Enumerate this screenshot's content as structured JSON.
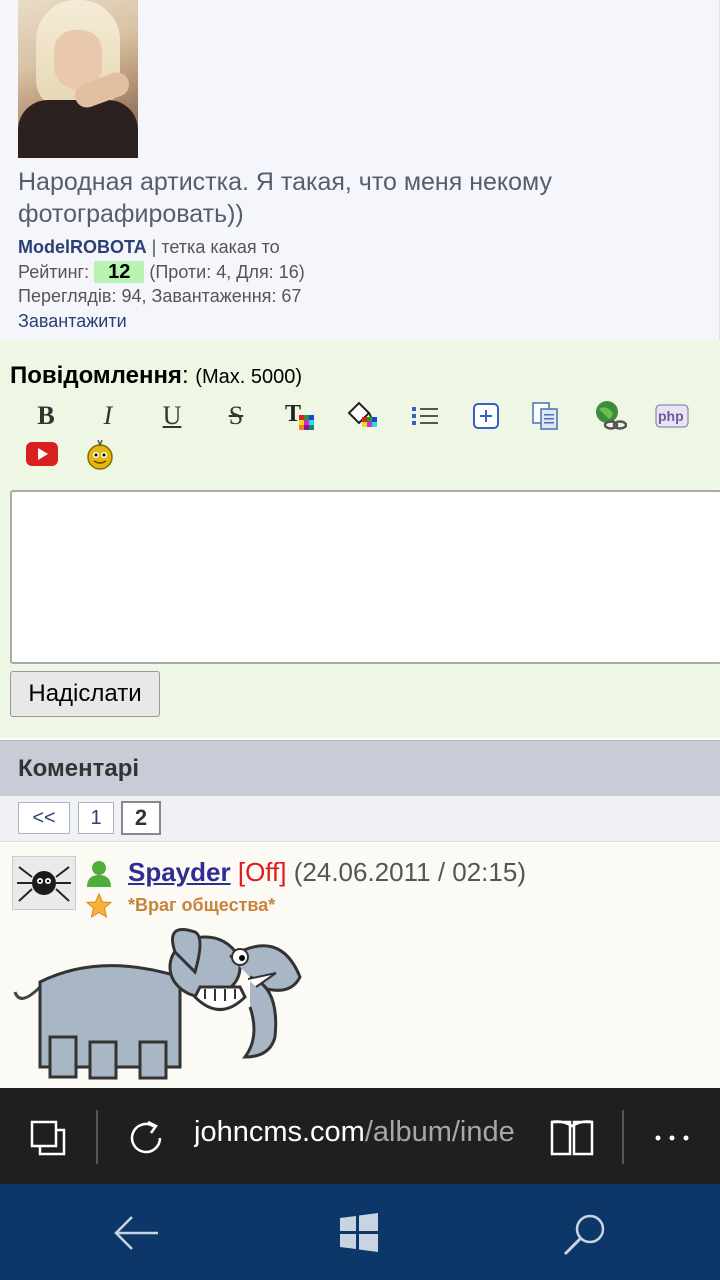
{
  "photo": {
    "caption": "Народная артистка. Я такая, что меня некому фотографировать))",
    "author": "ModelROBOTA",
    "author_note": "| тетка какая то",
    "rating_label": "Рейтинг:",
    "rating_value": "12",
    "rating_votes": "(Проти: 4, Для: 16)",
    "stats": "Переглядів: 94, Завантаження: 67",
    "download_label": "Завантажити"
  },
  "message": {
    "label": "Повідомлення",
    "max": "(Max. 5000)",
    "toolbar": [
      "bold-icon",
      "italic-icon",
      "underline-icon",
      "strikethrough-icon",
      "text-color-icon",
      "background-color-icon",
      "list-icon",
      "spoiler-icon",
      "code-icon",
      "url-icon",
      "php-icon",
      "youtube-icon",
      "smiley-icon"
    ],
    "toolbar_text": {
      "bold": "B",
      "italic": "I",
      "underline": "U",
      "strike": "S",
      "php": "php"
    },
    "input_value": "",
    "send_label": "Надіслати"
  },
  "comments": {
    "title": "Коментарі",
    "pager": [
      "<<",
      "1",
      "2"
    ],
    "current_page": "2",
    "items": [
      {
        "nick": "Spayder",
        "status_flag": "[Off]",
        "time": "(24.06.2011 / 02:15)",
        "rank": "*Враг общества*"
      }
    ]
  },
  "browser": {
    "url_host": "johncms.com",
    "url_path": "/album/inde"
  },
  "colors": {
    "accent_green": "#b9f3b3",
    "nick_color": "#2e2d93",
    "off_color": "#e01a1a",
    "rank_color": "#c8843d",
    "nav_bar": "#0c3768"
  }
}
